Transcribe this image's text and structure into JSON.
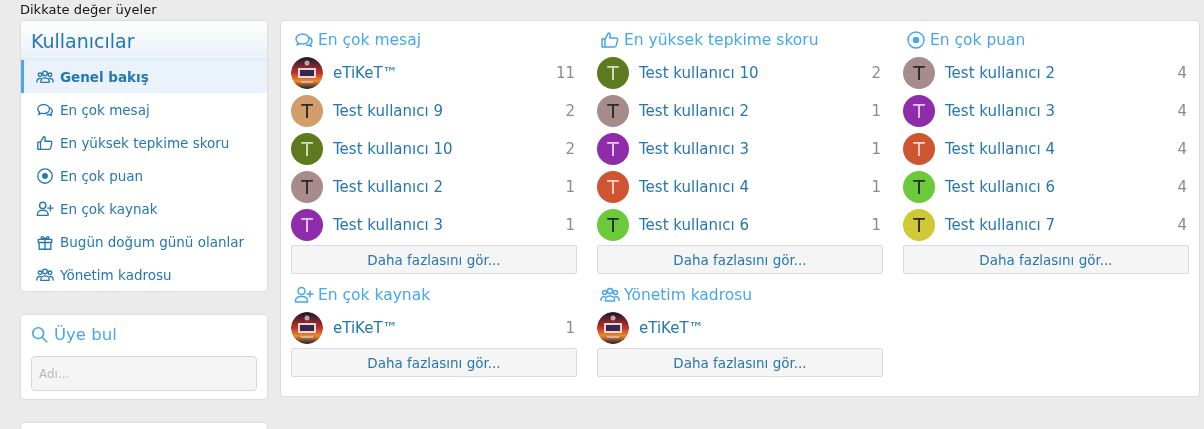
{
  "page_title": "Dikkate değer üyeler",
  "sidebar": {
    "title": "Kullanıcılar",
    "items": [
      {
        "label": "Genel bakış",
        "kind": "users",
        "selected": true
      },
      {
        "label": "En çok mesaj",
        "kind": "chat",
        "selected": false
      },
      {
        "label": "En yüksek tepkime skoru",
        "kind": "thumb",
        "selected": false
      },
      {
        "label": "En çok puan",
        "kind": "target",
        "selected": false
      },
      {
        "label": "En çok kaynak",
        "kind": "userplus",
        "selected": false
      },
      {
        "label": "Bugün doğum günü olanlar",
        "kind": "gift",
        "selected": false
      },
      {
        "label": "Yönetim kadrosu",
        "kind": "users",
        "selected": false
      }
    ]
  },
  "member_search": {
    "title": "Üye bul",
    "placeholder": "Adı..."
  },
  "sections": [
    {
      "title": "En çok mesaj",
      "kind": "chat",
      "more": "Daha fazlasını gör...",
      "members": [
        {
          "name": "eTiKeT™",
          "count": "11"
        },
        {
          "name": "Test kullanıcı 9",
          "count": "2",
          "avatar": {
            "kind": "letter",
            "letter": "T",
            "color": "#d39d6b"
          }
        },
        {
          "name": "Test kullanıcı 10",
          "count": "2",
          "avatar": {
            "kind": "letter",
            "letter": "T",
            "color": "#5e7a1e"
          }
        },
        {
          "name": "Test kullanıcı 2",
          "count": "1",
          "avatar": {
            "kind": "letter",
            "letter": "T",
            "color": "#a88c8c"
          }
        },
        {
          "name": "Test kullanıcı 3",
          "count": "1",
          "avatar": {
            "kind": "letter",
            "letter": "T",
            "color": "#8e2cac"
          }
        }
      ]
    },
    {
      "title": "En yüksek tepkime skoru",
      "kind": "thumb",
      "more": "Daha fazlasını gör...",
      "members": [
        {
          "name": "Test kullanıcı 10",
          "count": "2",
          "avatar": {
            "kind": "letter",
            "letter": "T",
            "color": "#5e7a1e"
          }
        },
        {
          "name": "Test kullanıcı 2",
          "count": "1",
          "avatar": {
            "kind": "letter",
            "letter": "T",
            "color": "#a88c8c"
          }
        },
        {
          "name": "Test kullanıcı 3",
          "count": "1",
          "avatar": {
            "kind": "letter",
            "letter": "T",
            "color": "#8e2cac"
          }
        },
        {
          "name": "Test kullanıcı 4",
          "count": "1",
          "avatar": {
            "kind": "letter",
            "letter": "T",
            "color": "#cf5530"
          }
        },
        {
          "name": "Test kullanıcı 6",
          "count": "1",
          "avatar": {
            "kind": "letter",
            "letter": "T",
            "color": "#6cc93a"
          }
        }
      ]
    },
    {
      "title": "En çok puan",
      "kind": "target",
      "more": "Daha fazlasını gör...",
      "members": [
        {
          "name": "Test kullanıcı 2",
          "count": "4",
          "avatar": {
            "kind": "letter",
            "letter": "T",
            "color": "#a88c8c"
          }
        },
        {
          "name": "Test kullanıcı 3",
          "count": "4",
          "avatar": {
            "kind": "letter",
            "letter": "T",
            "color": "#8e2cac"
          }
        },
        {
          "name": "Test kullanıcı 4",
          "count": "4",
          "avatar": {
            "kind": "letter",
            "letter": "T",
            "color": "#cf5530"
          }
        },
        {
          "name": "Test kullanıcı 6",
          "count": "4",
          "avatar": {
            "kind": "letter",
            "letter": "T",
            "color": "#6cc93a"
          }
        },
        {
          "name": "Test kullanıcı 7",
          "count": "4",
          "avatar": {
            "kind": "letter",
            "letter": "T",
            "color": "#cfc935"
          }
        }
      ]
    },
    {
      "title": "En çok kaynak",
      "kind": "userplus",
      "more": "Daha fazlasını gör...",
      "members": [
        {
          "name": "eTiKeT™",
          "count": "1"
        }
      ]
    },
    {
      "title": "Yönetim kadrosu",
      "kind": "users",
      "more": "Daha fazlasını gör...",
      "members": [
        {
          "name": "eTiKeT™"
        }
      ]
    }
  ]
}
